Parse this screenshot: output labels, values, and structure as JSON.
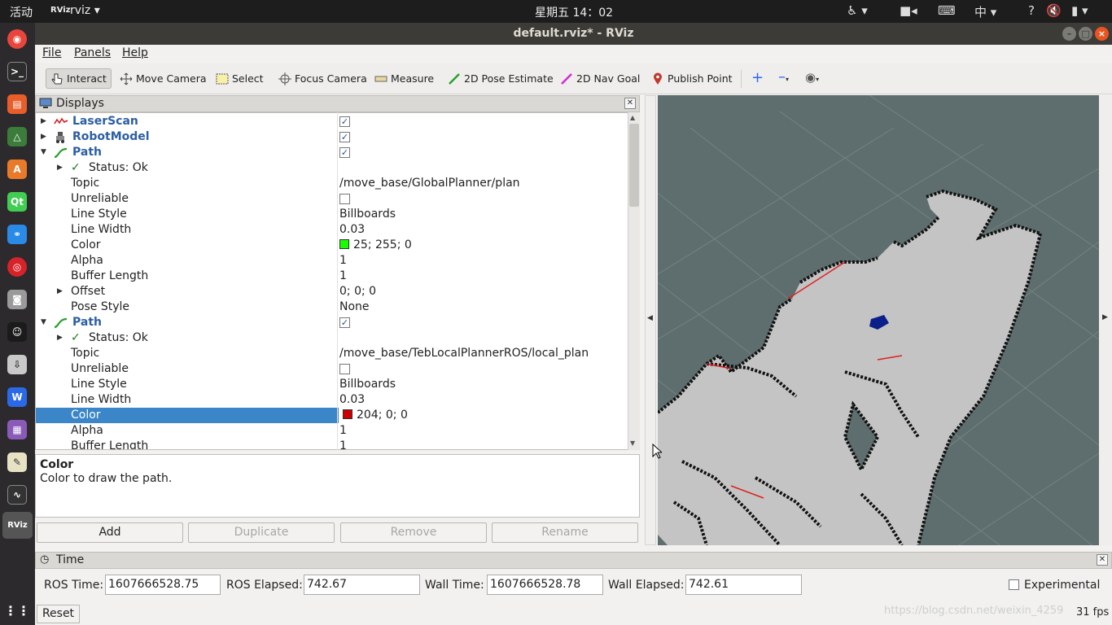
{
  "topbar": {
    "activities": "活动",
    "app_name": "rviz",
    "clock": "星期五 14：02",
    "input_method": "中"
  },
  "window": {
    "title": "default.rviz* - RViz"
  },
  "menu": [
    {
      "label": "File"
    },
    {
      "label": "Panels"
    },
    {
      "label": "Help"
    }
  ],
  "toolbar": [
    {
      "label": "Interact",
      "icon": "interact-icon",
      "active": true
    },
    {
      "label": "Move Camera",
      "icon": "move-camera-icon"
    },
    {
      "label": "Select",
      "icon": "select-icon"
    },
    {
      "label": "Focus Camera",
      "icon": "focus-camera-icon"
    },
    {
      "label": "Measure",
      "icon": "measure-icon"
    },
    {
      "label": "2D Pose Estimate",
      "icon": "pose-estimate-icon"
    },
    {
      "label": "2D Nav Goal",
      "icon": "nav-goal-icon"
    },
    {
      "label": "Publish Point",
      "icon": "publish-point-icon"
    }
  ],
  "displays": {
    "title": "Displays",
    "rows": [
      {
        "label": "LaserScan",
        "type": "display",
        "checked": true
      },
      {
        "label": "RobotModel",
        "type": "display",
        "checked": true
      },
      {
        "label": "Path",
        "type": "display",
        "checked": true
      },
      {
        "label": "Status: Ok",
        "type": "status"
      },
      {
        "label": "Topic",
        "value": "/move_base/GlobalPlanner/plan"
      },
      {
        "label": "Unreliable",
        "checkbox": false
      },
      {
        "label": "Line Style",
        "value": "Billboards"
      },
      {
        "label": "Line Width",
        "value": "0.03"
      },
      {
        "label": "Color",
        "value": "25; 255; 0",
        "swatch": "#19ff00"
      },
      {
        "label": "Alpha",
        "value": "1"
      },
      {
        "label": "Buffer Length",
        "value": "1"
      },
      {
        "label": "Offset",
        "value": "0; 0; 0",
        "expandable": true
      },
      {
        "label": "Pose Style",
        "value": "None"
      },
      {
        "label": "Path",
        "type": "display",
        "checked": true
      },
      {
        "label": "Status: Ok",
        "type": "status"
      },
      {
        "label": "Topic",
        "value": "/move_base/TebLocalPlannerROS/local_plan"
      },
      {
        "label": "Unreliable",
        "checkbox": false
      },
      {
        "label": "Line Style",
        "value": "Billboards"
      },
      {
        "label": "Line Width",
        "value": "0.03"
      },
      {
        "label": "Color",
        "value": "204; 0; 0",
        "swatch": "#cc0000",
        "selected": true
      },
      {
        "label": "Alpha",
        "value": "1"
      },
      {
        "label": "Buffer Length",
        "value": "1"
      }
    ]
  },
  "description": {
    "title": "Color",
    "text": "Color to draw the path."
  },
  "buttons": [
    {
      "label": "Add",
      "enabled": true
    },
    {
      "label": "Duplicate",
      "enabled": false
    },
    {
      "label": "Remove",
      "enabled": false
    },
    {
      "label": "Rename",
      "enabled": false
    }
  ],
  "time": {
    "title": "Time",
    "ros_time_label": "ROS Time:",
    "ros_time": "1607666528.75",
    "ros_elapsed_label": "ROS Elapsed:",
    "ros_elapsed": "742.67",
    "wall_time_label": "Wall Time:",
    "wall_time": "1607666528.78",
    "wall_elapsed_label": "Wall Elapsed:",
    "wall_elapsed": "742.61",
    "experimental_label": "Experimental",
    "reset_label": "Reset",
    "fps": "31 fps"
  },
  "watermark": "https://blog.csdn.net/weixin_4259",
  "colors": {
    "selection": "#3a86c8",
    "display_label": "#2c5ea4",
    "viewport_bg": "#5e6d6d",
    "map_free": "#c4c4c4"
  }
}
